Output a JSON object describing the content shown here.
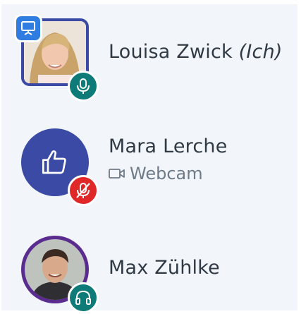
{
  "participants": [
    {
      "name": "Louisa Zwick",
      "self_tag": "(Ich)",
      "avatar": "photo-avatar-woman",
      "role_icon": "presenter-icon",
      "status_icon": "microphone-icon",
      "status_color": "#0f7b78"
    },
    {
      "name": "Mara Lerche",
      "avatar": "thumbs-up-icon",
      "avatar_color": "#3b4aa5",
      "status_icon": "microphone-muted-icon",
      "status_color": "#e02828",
      "sub_label": "Webcam",
      "sub_icon": "webcam-icon"
    },
    {
      "name": "Max Zühlke",
      "avatar": "photo-avatar-man",
      "avatar_ring_color": "#5a2c8f",
      "status_icon": "headphones-icon",
      "status_color": "#0f7b78"
    }
  ],
  "colors": {
    "background": "#f2f5f9",
    "presenter_frame": "#3b4aa5",
    "text": "#303a45",
    "subtext": "#6f7b88"
  }
}
